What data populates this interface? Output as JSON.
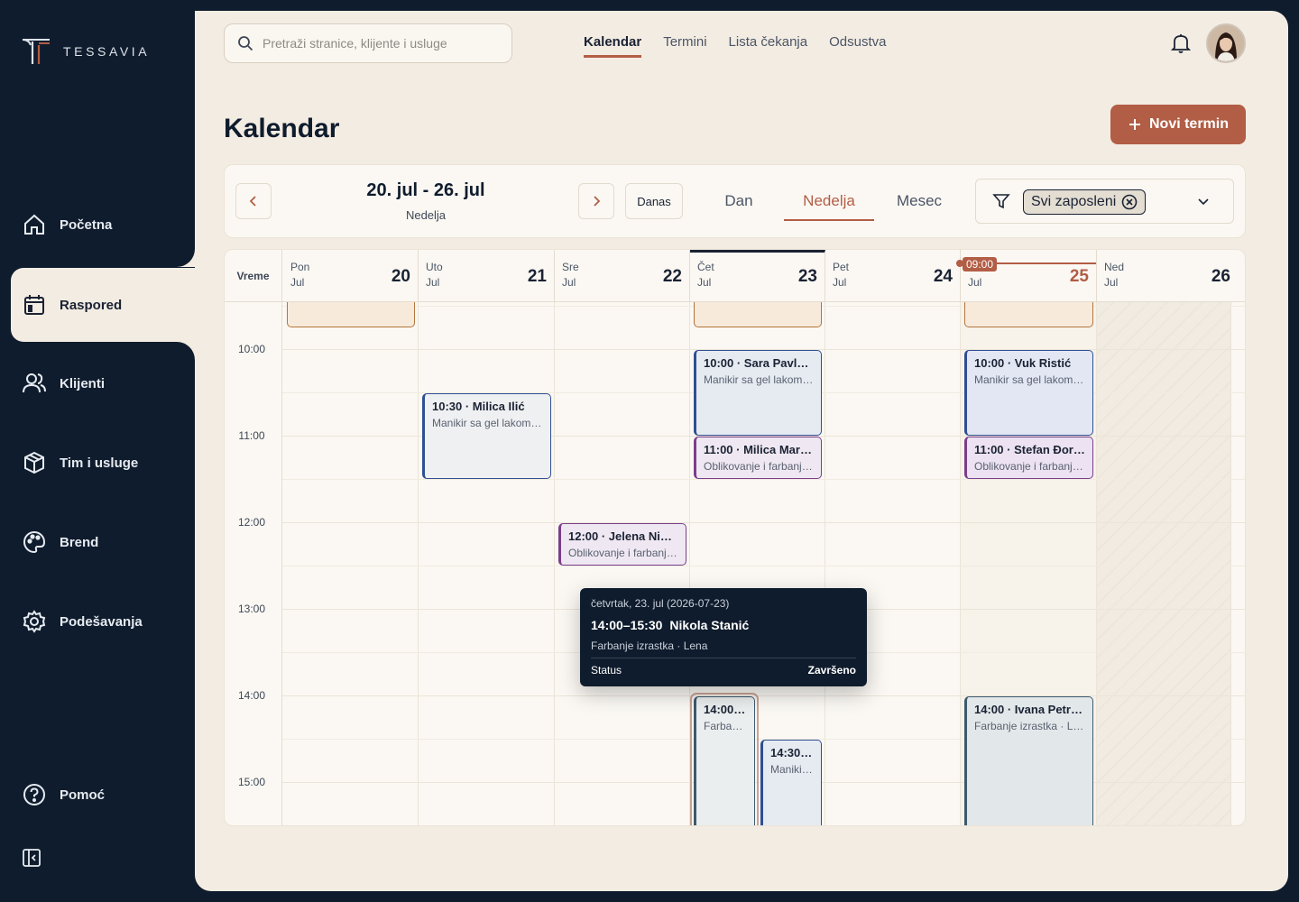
{
  "brand": {
    "name": "TESSAVIA"
  },
  "sidebar": {
    "items": [
      {
        "label": "Početna",
        "icon": "home-icon"
      },
      {
        "label": "Raspored",
        "icon": "calendar-icon",
        "active": true
      },
      {
        "label": "Klijenti",
        "icon": "users-icon"
      },
      {
        "label": "Tim i usluge",
        "icon": "box-icon"
      },
      {
        "label": "Brend",
        "icon": "palette-icon"
      },
      {
        "label": "Podešavanja",
        "icon": "gear-icon"
      }
    ],
    "help_label": "Pomoć"
  },
  "header": {
    "search_placeholder": "Pretraži stranice, klijente i usluge",
    "tabs": [
      "Kalendar",
      "Termini",
      "Lista čekanja",
      "Odsustva"
    ],
    "active_tab": "Kalendar"
  },
  "page": {
    "title": "Kalendar",
    "new_button": "Novi termin"
  },
  "toolbar": {
    "range_title": "20. jul - 26. jul",
    "range_sub": "Nedelja",
    "today": "Danas",
    "views": [
      "Dan",
      "Nedelja",
      "Mesec"
    ],
    "active_view": "Nedelja",
    "employee_filter": "Svi zaposleni"
  },
  "calendar": {
    "time_header": "Vreme",
    "now_label": "09:00",
    "days": [
      {
        "name": "Pon",
        "month": "Jul",
        "num": "20"
      },
      {
        "name": "Uto",
        "month": "Jul",
        "num": "21"
      },
      {
        "name": "Sre",
        "month": "Jul",
        "num": "22"
      },
      {
        "name": "Čet",
        "month": "Jul",
        "num": "23"
      },
      {
        "name": "Pet",
        "month": "Jul",
        "num": "24"
      },
      {
        "name": "",
        "month": "Jul",
        "num": "25"
      },
      {
        "name": "Ned",
        "month": "Jul",
        "num": "26"
      }
    ],
    "hours": [
      "10:00",
      "11:00",
      "12:00",
      "13:00",
      "14:00",
      "15:00"
    ],
    "events": [
      {
        "title": "10:00 · Sara Pavlov…",
        "sub": "Manikir sa gel lakom · …"
      },
      {
        "title": "11:00 · Milica Mark…",
        "sub": "Oblikovanje i farbanje…"
      },
      {
        "title": "10:30 · Milica Ilić",
        "sub": "Manikir sa gel lakom · …"
      },
      {
        "title": "12:00 · Jelena Niko…",
        "sub": "Oblikovanje i farbanje…"
      },
      {
        "title": "10:00 · Vuk Ristić",
        "sub": "Manikir sa gel lakom · …"
      },
      {
        "title": "11:00 · Stefan Đor…",
        "sub": "Oblikovanje i farbanje…"
      },
      {
        "title": "14:00 · Ivana Petro…",
        "sub": "Farbanje izrastka · Le…"
      },
      {
        "title": "14:00 ·…",
        "sub": "Farbanj…"
      },
      {
        "title": "14:30 ·…",
        "sub": "Manikir …"
      }
    ]
  },
  "tooltip": {
    "date": "četvrtak, 23. jul (2026-07-23)",
    "time": "14:00–15:30",
    "client": "Nikola Stanić",
    "service": "Farbanje izrastka · Lena",
    "status_label": "Status",
    "status_value": "Završeno"
  },
  "colors": {
    "accent": "#b25d45",
    "navy": "#0f1c2d",
    "cream": "#f3ece2"
  }
}
